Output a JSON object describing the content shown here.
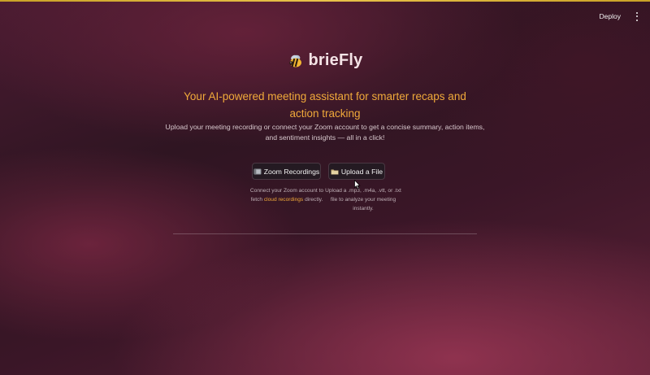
{
  "header": {
    "deploy_label": "Deploy",
    "menu_icon": "kebab-menu-icon"
  },
  "hero": {
    "logo_icon": "bee-icon",
    "app_name": "brieFly",
    "tagline": "Your AI-powered meeting assistant for smarter recaps and action tracking",
    "description": "Upload your meeting recording or connect your Zoom account to get a concise summary, action items, and sentiment insights — all in a click!"
  },
  "actions": {
    "zoom": {
      "icon": "film-icon",
      "label": "Zoom Recordings",
      "caption_before": "Connect your Zoom account to fetch ",
      "caption_highlight": "cloud recordings",
      "caption_after": " directly."
    },
    "upload": {
      "icon": "folder-icon",
      "label": "Upload a File",
      "caption": "Upload a .mp3, .m4a, .vtt, or .txt file to analyze your meeting instantly."
    }
  },
  "colors": {
    "accent": "#f0a93a",
    "top_bar": "#e8c24a",
    "button_bg": "#241a22"
  }
}
